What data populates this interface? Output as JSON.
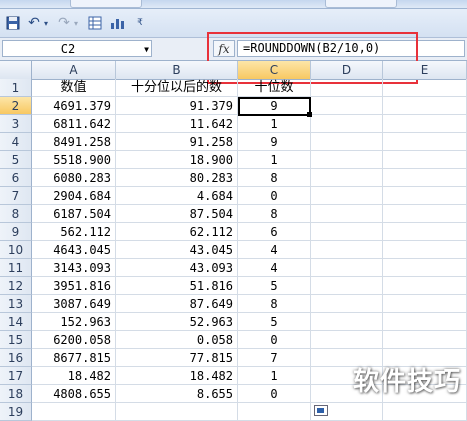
{
  "formula_bar": {
    "name_box": "C2",
    "fx_label": "fx",
    "formula": "=ROUNDDOWN(B2/10,0)"
  },
  "columns": [
    "A",
    "B",
    "C",
    "D",
    "E"
  ],
  "header_row": {
    "row_number": "1",
    "a": "数值",
    "b": "十分位以后的数",
    "c": "十位数"
  },
  "rows": [
    {
      "n": "2",
      "a": "4691.379",
      "b": "91.379",
      "c": "9"
    },
    {
      "n": "3",
      "a": "6811.642",
      "b": "11.642",
      "c": "1"
    },
    {
      "n": "4",
      "a": "8491.258",
      "b": "91.258",
      "c": "9"
    },
    {
      "n": "5",
      "a": "5518.900",
      "b": "18.900",
      "c": "1"
    },
    {
      "n": "6",
      "a": "6080.283",
      "b": "80.283",
      "c": "8"
    },
    {
      "n": "7",
      "a": "2904.684",
      "b": "4.684",
      "c": "0"
    },
    {
      "n": "8",
      "a": "6187.504",
      "b": "87.504",
      "c": "8"
    },
    {
      "n": "9",
      "a": "562.112",
      "b": "62.112",
      "c": "6"
    },
    {
      "n": "10",
      "a": "4643.045",
      "b": "43.045",
      "c": "4"
    },
    {
      "n": "11",
      "a": "3143.093",
      "b": "43.093",
      "c": "4"
    },
    {
      "n": "12",
      "a": "3951.816",
      "b": "51.816",
      "c": "5"
    },
    {
      "n": "13",
      "a": "3087.649",
      "b": "87.649",
      "c": "8"
    },
    {
      "n": "14",
      "a": "152.963",
      "b": "52.963",
      "c": "5"
    },
    {
      "n": "15",
      "a": "6200.058",
      "b": "0.058",
      "c": "0"
    },
    {
      "n": "16",
      "a": "8677.815",
      "b": "77.815",
      "c": "7"
    },
    {
      "n": "17",
      "a": "18.482",
      "b": "18.482",
      "c": "1"
    },
    {
      "n": "18",
      "a": "4808.655",
      "b": "8.655",
      "c": "0"
    }
  ],
  "last_row_number": "19",
  "watermark": "软件技巧",
  "colors": {
    "highlight_box": "#e8313a",
    "active_header": "#f8c862"
  }
}
